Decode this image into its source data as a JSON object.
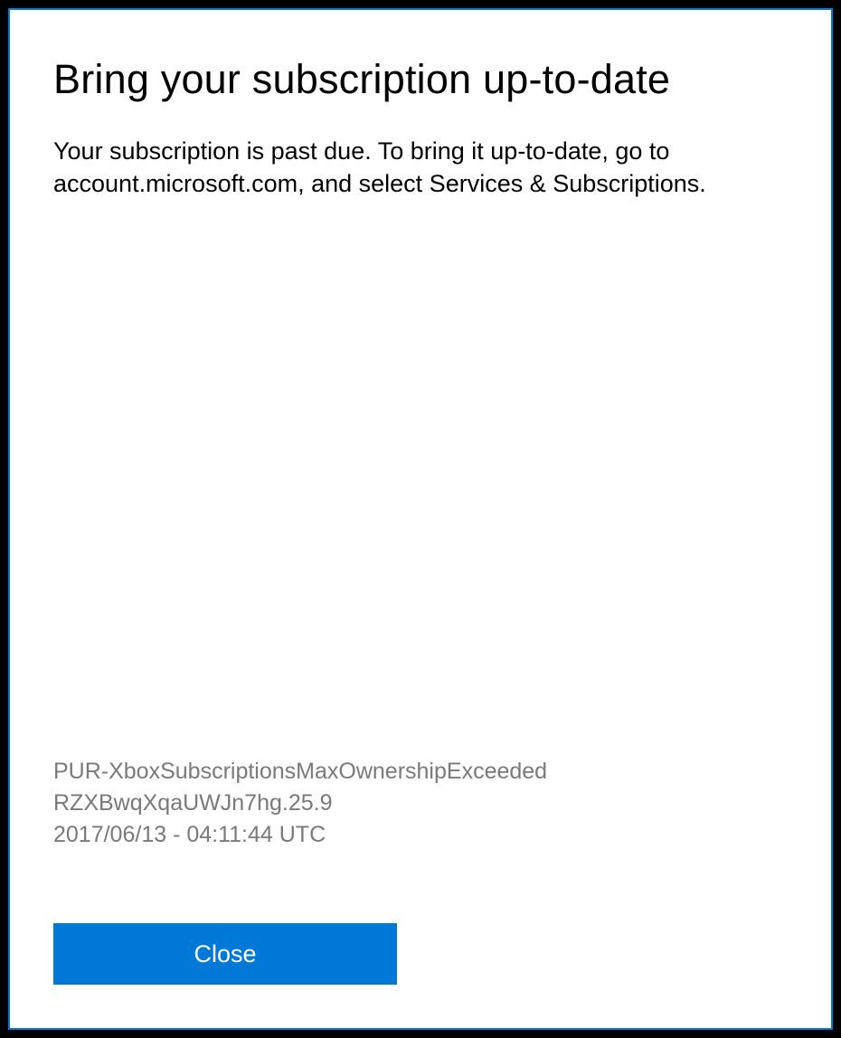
{
  "dialog": {
    "title": "Bring your subscription up-to-date",
    "message": "Your subscription is past due. To bring it up-to-date, go to account.microsoft.com, and select Services & Subscriptions.",
    "error": {
      "code": "PUR-XboxSubscriptionsMaxOwnershipExceeded",
      "id": "RZXBwqXqaUWJn7hg.25.9",
      "timestamp": "2017/06/13 - 04:11:44 UTC"
    },
    "close_label": "Close"
  }
}
